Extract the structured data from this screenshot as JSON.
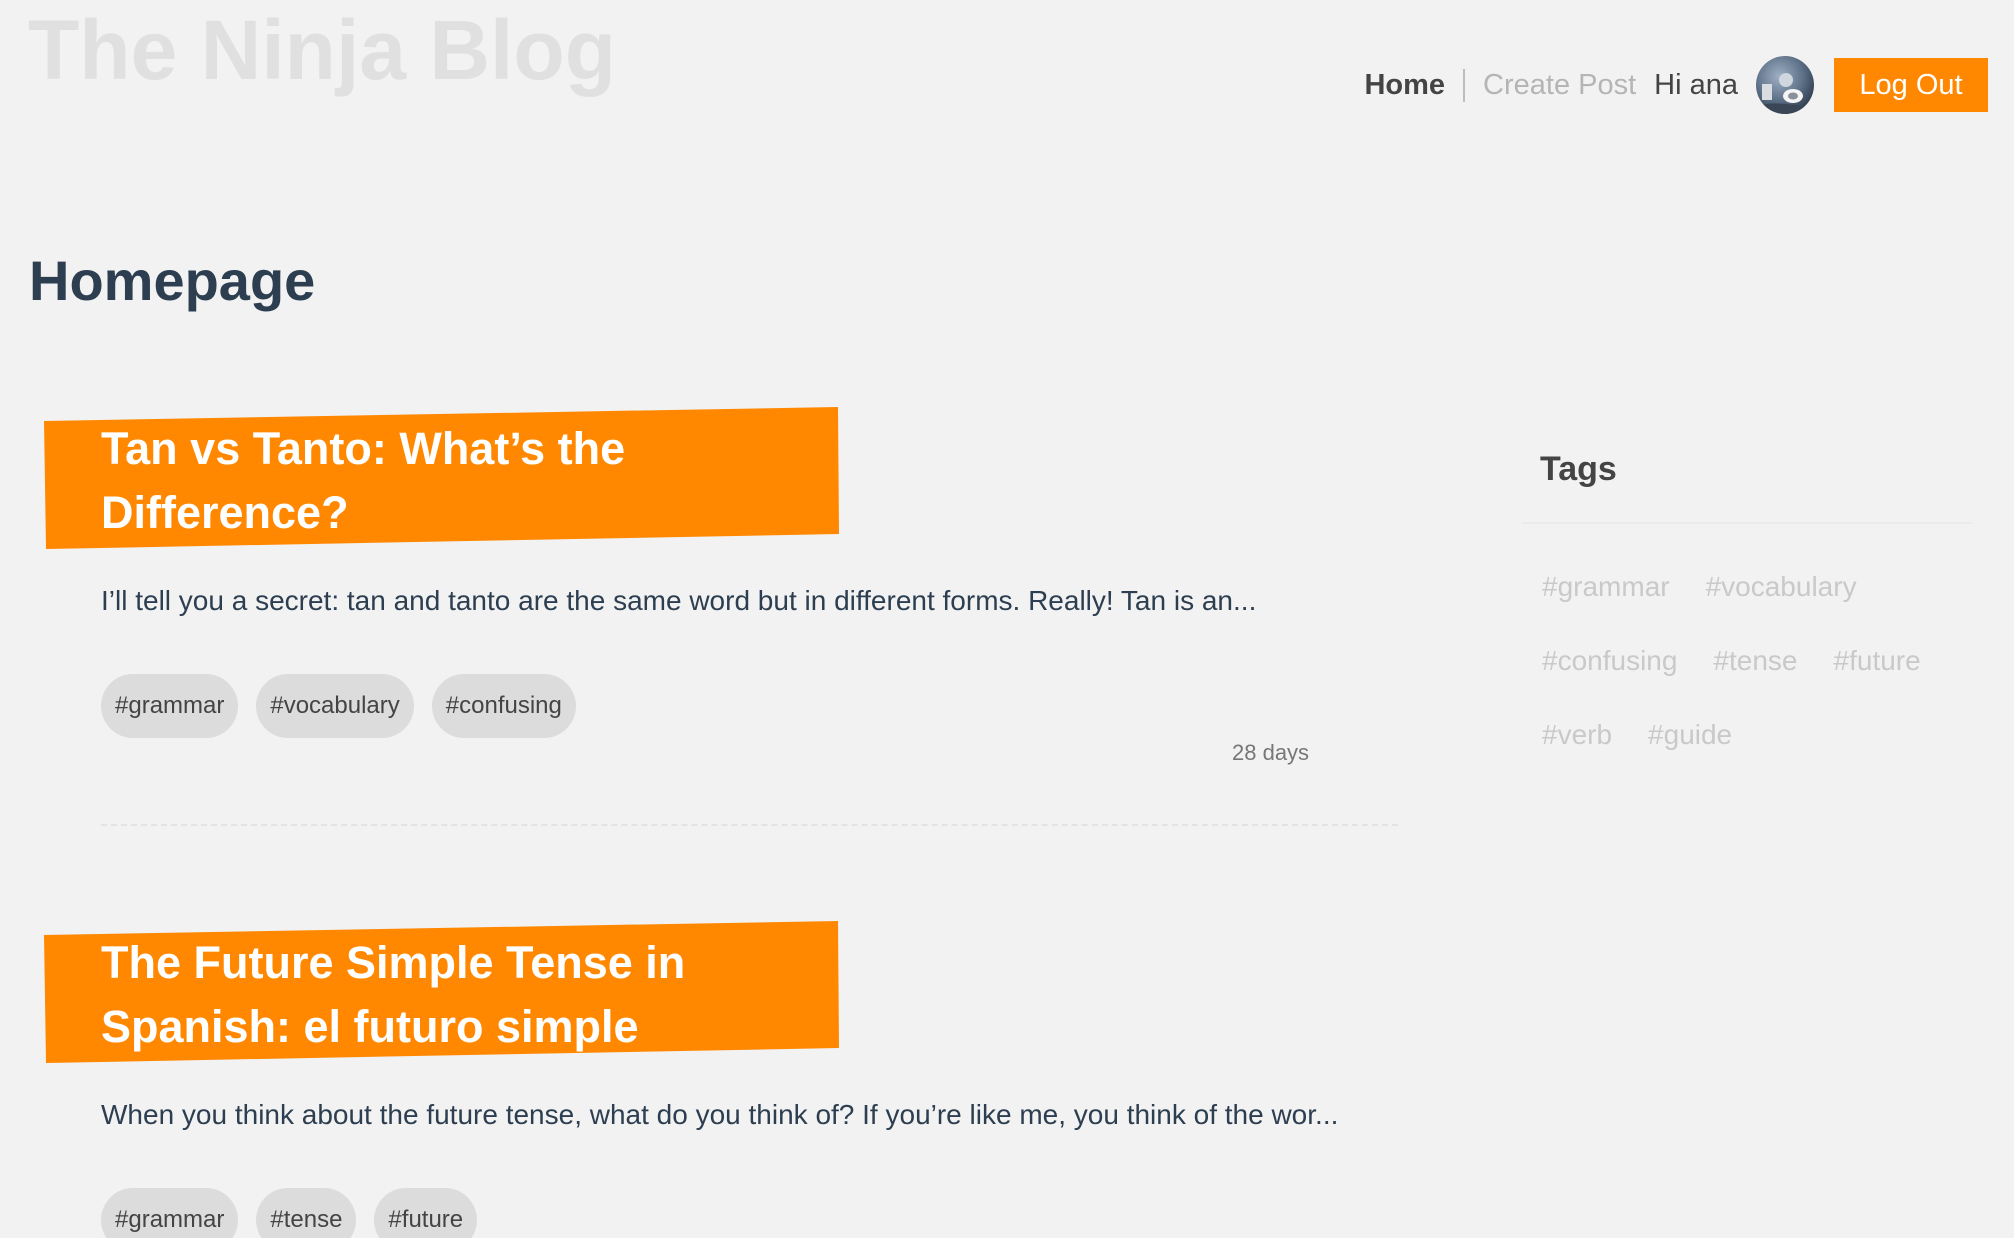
{
  "header": {
    "site_title": "The Ninja Blog",
    "nav": {
      "home": "Home",
      "create_post": "Create Post",
      "greeting": "Hi ana",
      "logout": "Log Out"
    }
  },
  "main": {
    "heading": "Homepage",
    "posts": [
      {
        "title": "Tan vs Tanto: What’s the Difference?",
        "excerpt": "I’ll tell you a secret: tan and tanto are the same word but in different forms. Really! Tan is an...",
        "tags": [
          "#grammar",
          "#vocabulary",
          "#confusing"
        ],
        "date": "28 days"
      },
      {
        "title": "The Future Simple Tense in Spanish: el futuro simple",
        "excerpt": "When you think about the future tense, what do you think of? If you’re like me, you think of the wor...",
        "tags": [
          "#grammar",
          "#tense",
          "#future"
        ]
      }
    ]
  },
  "sidebar": {
    "title": "Tags",
    "tags": [
      "#grammar",
      "#vocabulary",
      "#confusing",
      "#tense",
      "#future",
      "#verb",
      "#guide"
    ]
  },
  "colors": {
    "accent": "#ff8800",
    "background": "#f2f2f2",
    "heading": "#2c3e50",
    "title_watermark": "#e0e0e0"
  },
  "icons": {
    "avatar": "user-avatar-photo"
  }
}
